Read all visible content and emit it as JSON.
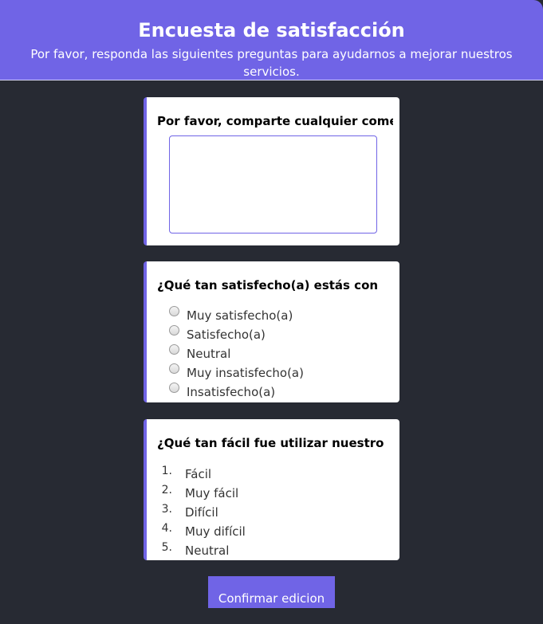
{
  "header": {
    "title": "Encuesta de satisfacción",
    "subtitle": "Por favor, responda las siguientes preguntas para ayudarnos a mejorar nuestros servicios."
  },
  "questions": [
    {
      "text": "Por favor, comparte cualquier comentario",
      "type": "textarea",
      "value": ""
    },
    {
      "text": "¿Qué tan satisfecho(a) estás con",
      "type": "radio",
      "options": [
        "Muy satisfecho(a)",
        "Satisfecho(a)",
        "Neutral",
        "Muy insatisfecho(a)",
        "Insatisfecho(a)"
      ]
    },
    {
      "text": "¿Qué tan fácil fue utilizar nuestro",
      "type": "ordered-list",
      "options": [
        "Fácil",
        "Muy fácil",
        "Difícil",
        "Muy difícil",
        "Neutral"
      ],
      "numbers": [
        "1.",
        "2.",
        "3.",
        "4.",
        "5."
      ]
    }
  ],
  "submit_label": "Confirmar edicion",
  "colors": {
    "accent": "#7064e6",
    "background": "#272a33",
    "card": "#ffffff"
  }
}
